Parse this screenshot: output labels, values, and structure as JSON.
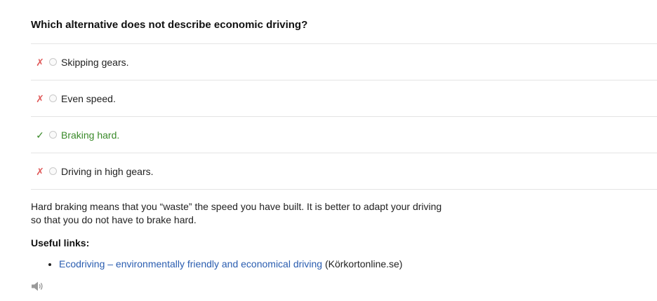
{
  "question": "Which alternative does not describe economic driving?",
  "options": [
    {
      "mark": "✗",
      "label": "Skipping gears.",
      "status": "wrong"
    },
    {
      "mark": "✗",
      "label": "Even speed.",
      "status": "wrong"
    },
    {
      "mark": "✓",
      "label": "Braking hard.",
      "status": "correct"
    },
    {
      "mark": "✗",
      "label": "Driving in high gears.",
      "status": "wrong"
    }
  ],
  "explanation": "Hard braking means that you “waste” the speed you have built. It is better to adapt your driving so that you do not have to brake hard.",
  "useful_links": {
    "heading": "Useful links:",
    "items": [
      {
        "link_text": "Ecodriving – environmentally friendly and economical driving",
        "source": "(Körkortonline.se)"
      }
    ]
  },
  "colors": {
    "correct": "#3a8a2a",
    "wrong": "#e05a5a",
    "link": "#2a5db0"
  },
  "icons": {
    "audio": "speaker-icon"
  }
}
